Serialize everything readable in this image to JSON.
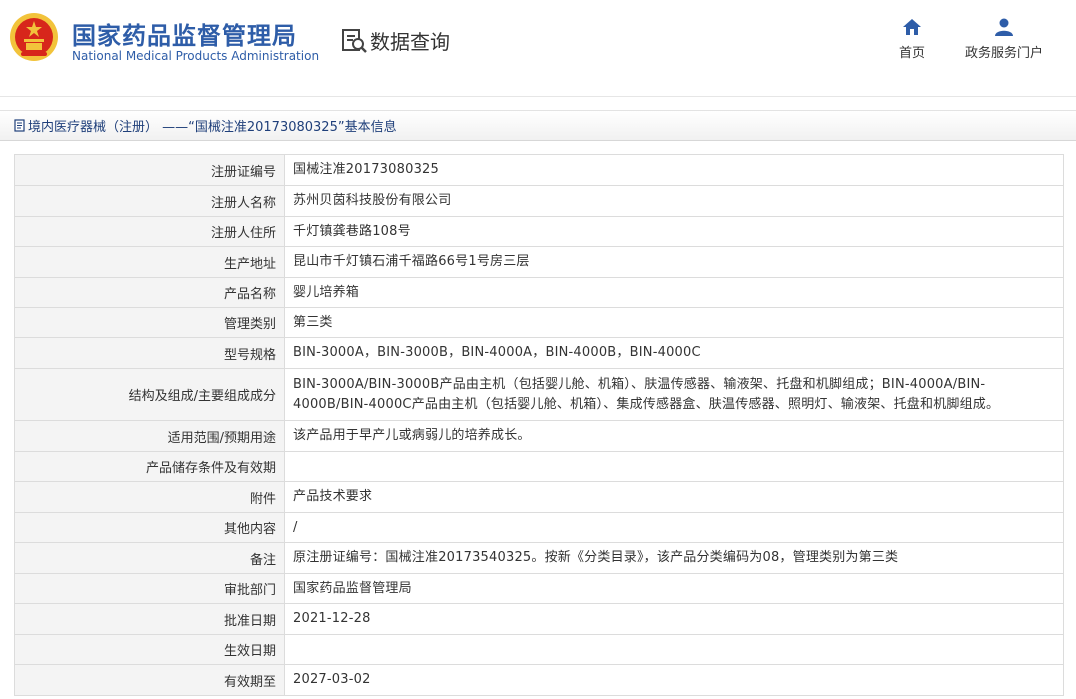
{
  "header": {
    "site_name_cn": "国家药品监督管理局",
    "site_name_en": "National Medical Products Administration",
    "query_label": "数据查询",
    "nav": [
      {
        "label": "首页",
        "icon": "home-icon"
      },
      {
        "label": "政务服务门户",
        "icon": "user-icon"
      }
    ]
  },
  "breadcrumb": {
    "text": "境内医疗器械（注册） ——“国械注准20173080325”基本信息",
    "icon": "document-icon"
  },
  "records": [
    {
      "label": "注册证编号",
      "value": "国械注准20173080325"
    },
    {
      "label": "注册人名称",
      "value": "苏州贝茵科技股份有限公司"
    },
    {
      "label": "注册人住所",
      "value": "千灯镇龚巷路108号"
    },
    {
      "label": "生产地址",
      "value": "昆山市千灯镇石浦千福路66号1号房三层"
    },
    {
      "label": "产品名称",
      "value": "婴儿培养箱"
    },
    {
      "label": "管理类别",
      "value": "第三类"
    },
    {
      "label": "型号规格",
      "value": "BIN-3000A，BIN-3000B，BIN-4000A，BIN-4000B，BIN-4000C"
    },
    {
      "label": "结构及组成/主要组成成分",
      "value": "BIN-3000A/BIN-3000B产品由主机（包括婴儿舱、机箱）、肤温传感器、输液架、托盘和机脚组成；BIN-4000A/BIN-4000B/BIN-4000C产品由主机（包括婴儿舱、机箱）、集成传感器盒、肤温传感器、照明灯、输液架、托盘和机脚组成。"
    },
    {
      "label": "适用范围/预期用途",
      "value": "该产品用于早产儿或病弱儿的培养成长。"
    },
    {
      "label": "产品储存条件及有效期",
      "value": ""
    },
    {
      "label": "附件",
      "value": "产品技术要求"
    },
    {
      "label": "其他内容",
      "value": "/"
    },
    {
      "label": "备注",
      "value": "原注册证编号：国械注准20173540325。按新《分类目录》，该产品分类编码为08，管理类别为第三类"
    },
    {
      "label": "审批部门",
      "value": "国家药品监督管理局"
    },
    {
      "label": "批准日期",
      "value": "2021-12-28"
    },
    {
      "label": "生效日期",
      "value": ""
    },
    {
      "label": "有效期至",
      "value": "2027-03-02"
    }
  ],
  "colors": {
    "brand": "#2e5da8",
    "label_bg": "#f4f4f4",
    "border": "#dcdcdc",
    "emblem_red": "#d7261b",
    "emblem_gold": "#f2c33b"
  }
}
